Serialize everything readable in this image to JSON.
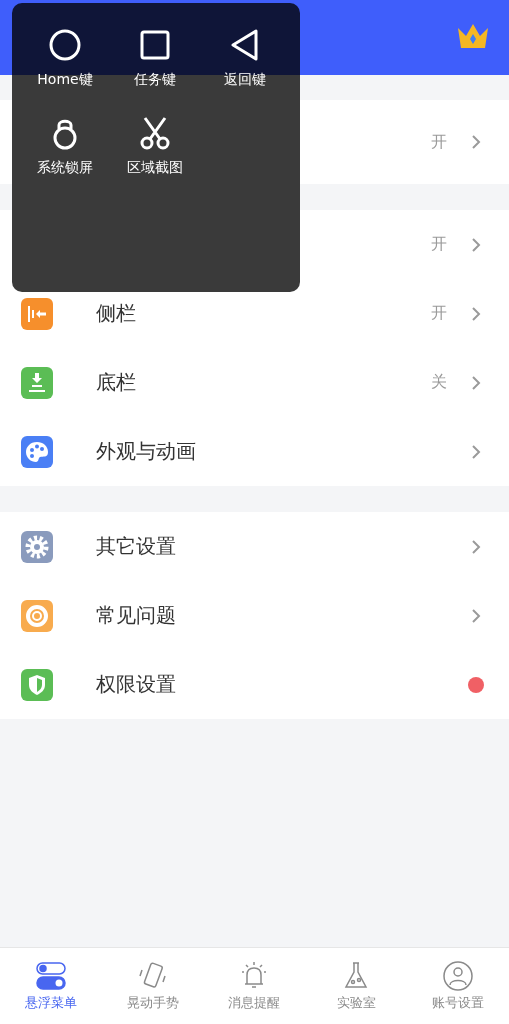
{
  "groups": [
    {
      "items": [
        {
          "value": "开",
          "chevron": true
        }
      ]
    },
    {
      "items": [
        {
          "value": "开",
          "chevron": true
        },
        {
          "label": "侧栏",
          "value": "开",
          "chevron": true,
          "color": "#f68f2c"
        },
        {
          "label": "底栏",
          "value": "关",
          "chevron": true,
          "color": "#5bbd55"
        },
        {
          "label": "外观与动画",
          "chevron": true,
          "color": "#4a7ff5"
        }
      ]
    },
    {
      "items": [
        {
          "label": "其它设置",
          "chevron": true,
          "color": "#8a9bbd"
        },
        {
          "label": "常见问题",
          "chevron": true,
          "color": "#f8ab4e"
        },
        {
          "label": "权限设置",
          "chevron": false,
          "color": "#5bbd55",
          "badge": {
            "color": "#f06065"
          }
        }
      ]
    }
  ],
  "floating_menu": {
    "items": [
      {
        "label": "Home键"
      },
      {
        "label": "任务键"
      },
      {
        "label": "返回键"
      },
      {
        "label": "系统锁屏"
      },
      {
        "label": "区域截图"
      }
    ]
  },
  "tabs": [
    {
      "label": "悬浮菜单",
      "selected": true
    },
    {
      "label": "晃动手势",
      "selected": false
    },
    {
      "label": "消息提醒",
      "selected": false
    },
    {
      "label": "实验室",
      "selected": false
    },
    {
      "label": "账号设置",
      "selected": false
    }
  ]
}
